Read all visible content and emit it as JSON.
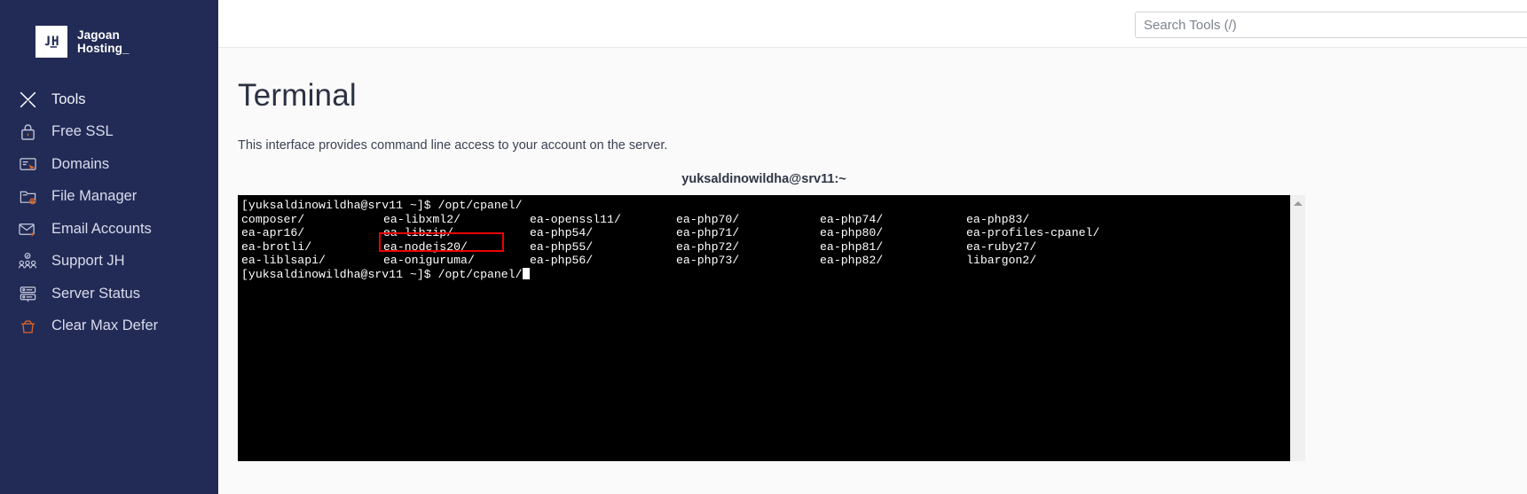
{
  "brand": {
    "name": "Jagoan\nHosting_",
    "mark_icon": "jh-monogram-icon"
  },
  "sidebar": {
    "items": [
      {
        "label": "Tools",
        "icon": "tools-crossed-icon"
      },
      {
        "label": "Free SSL",
        "icon": "padlock-icon"
      },
      {
        "label": "Domains",
        "icon": "domain-card-click-icon"
      },
      {
        "label": "File Manager",
        "icon": "folder-gear-icon"
      },
      {
        "label": "Email Accounts",
        "icon": "envelope-plus-icon"
      },
      {
        "label": "Support JH",
        "icon": "people-check-icon"
      },
      {
        "label": "Server Status",
        "icon": "server-rack-icon"
      },
      {
        "label": "Clear Max Defer",
        "icon": "trash-bin-icon"
      }
    ]
  },
  "topbar": {
    "search_placeholder": "Search Tools (/)",
    "search_value": ""
  },
  "page": {
    "title": "Terminal",
    "description": "This interface provides command line access to your account on the server."
  },
  "terminal": {
    "title": "yuksaldinowildha@srv11:~",
    "prompt_line": "[yuksaldinowildha@srv11 ~]$ /opt/cpanel/",
    "final_prompt": "[yuksaldinowildha@srv11 ~]$ /opt/cpanel/",
    "highlighted_entry": "ea-nodejs20/",
    "highlight_color": "#ee0000",
    "rows": [
      [
        "composer/",
        "ea-libxml2/",
        "ea-openssl11/",
        "ea-php70/",
        "ea-php74/",
        "ea-php83/"
      ],
      [
        "ea-apr16/",
        "ea-libzip/",
        "ea-php54/",
        "ea-php71/",
        "ea-php80/",
        "ea-profiles-cpanel/"
      ],
      [
        "ea-brotli/",
        "ea-nodejs20/",
        "ea-php55/",
        "ea-php72/",
        "ea-php81/",
        "ea-ruby27/"
      ],
      [
        "ea-liblsapi/",
        "ea-oniguruma/",
        "ea-php56/",
        "ea-php73/",
        "ea-php82/",
        "libargon2/"
      ]
    ],
    "scrollbar": {
      "arrow_icon": "scroll-up-arrow-icon"
    }
  }
}
